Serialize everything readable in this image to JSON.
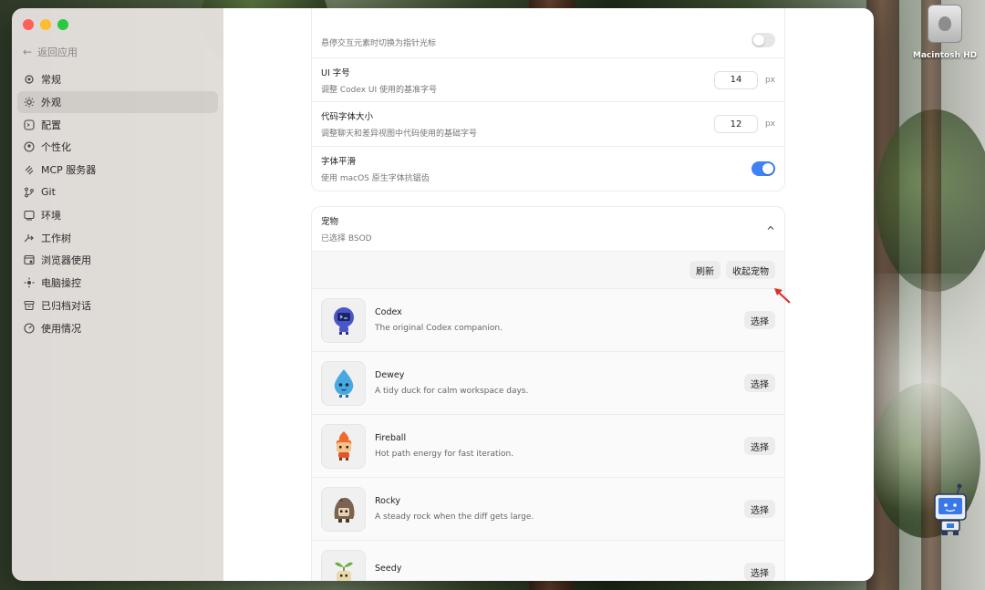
{
  "desktop": {
    "hd_label": "Macintosh HD"
  },
  "sidebar": {
    "back_label": "返回应用",
    "items": [
      {
        "label": "常规",
        "icon": "gear-icon"
      },
      {
        "label": "外观",
        "icon": "sun-icon",
        "active": true
      },
      {
        "label": "配置",
        "icon": "config-icon"
      },
      {
        "label": "个性化",
        "icon": "person-icon"
      },
      {
        "label": "MCP 服务器",
        "icon": "mcp-icon"
      },
      {
        "label": "Git",
        "icon": "git-branch-icon"
      },
      {
        "label": "环境",
        "icon": "monitor-icon"
      },
      {
        "label": "工作树",
        "icon": "worktree-icon"
      },
      {
        "label": "浏览器使用",
        "icon": "browser-icon"
      },
      {
        "label": "电脑操控",
        "icon": "computer-control-icon"
      },
      {
        "label": "已归档对话",
        "icon": "archive-icon"
      },
      {
        "label": "使用情况",
        "icon": "gauge-icon"
      }
    ]
  },
  "settings": {
    "pointer_desc": "悬停交互元素时切换为指针光标",
    "ui_font_title": "UI 字号",
    "ui_font_desc": "调整 Codex UI 使用的基准字号",
    "ui_font_value": "14",
    "ui_font_unit": "px",
    "code_font_title": "代码字体大小",
    "code_font_desc": "调整聊天和差异视图中代码使用的基础字号",
    "code_font_value": "12",
    "code_font_unit": "px",
    "smoothing_title": "字体平滑",
    "smoothing_desc": "使用 macOS 原生字体抗锯齿",
    "smoothing_on": true
  },
  "pets": {
    "title": "宠物",
    "selected": "已选择 BSOD",
    "refresh_label": "刷新",
    "collapse_label": "收起宠物",
    "select_label": "选择",
    "items": [
      {
        "name": "Codex",
        "desc": "The original Codex companion.",
        "icon": "codex-pet-icon"
      },
      {
        "name": "Dewey",
        "desc": "A tidy duck for calm workspace days.",
        "icon": "dewey-pet-icon"
      },
      {
        "name": "Fireball",
        "desc": "Hot path energy for fast iteration.",
        "icon": "fireball-pet-icon"
      },
      {
        "name": "Rocky",
        "desc": "A steady rock when the diff gets large.",
        "icon": "rocky-pet-icon"
      },
      {
        "name": "Seedy",
        "desc": "",
        "icon": "seedy-pet-icon"
      }
    ]
  },
  "colors": {
    "accent": "#3d82f6",
    "annotation_arrow": "#d8322b"
  }
}
